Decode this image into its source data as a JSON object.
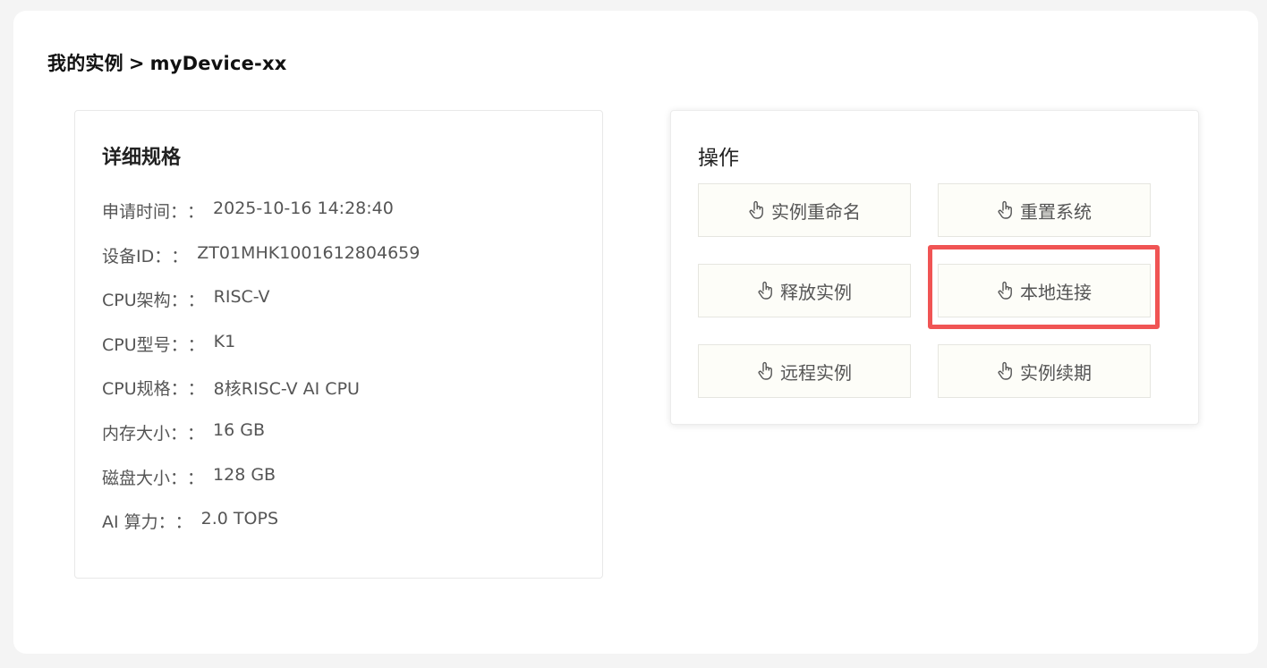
{
  "breadcrumb": {
    "parent": "我的实例",
    "separator": ">",
    "current": "myDevice-xx"
  },
  "specs": {
    "title": "详细规格",
    "colon": "：",
    "rows": [
      {
        "label": "申请时间：",
        "value": "2025-10-16 14:28:40"
      },
      {
        "label": "设备ID：",
        "value": "ZT01MHK1001612804659"
      },
      {
        "label": "CPU架构：",
        "value": "RISC-V"
      },
      {
        "label": "CPU型号：",
        "value": "K1"
      },
      {
        "label": "CPU规格：",
        "value": "8核RISC-V AI CPU"
      },
      {
        "label": "内存大小：",
        "value": "16 GB"
      },
      {
        "label": "磁盘大小：",
        "value": "128 GB"
      },
      {
        "label": "AI 算力：",
        "value": "2.0 TOPS"
      }
    ]
  },
  "operations": {
    "title": "操作",
    "icon": "pointer-hand-icon",
    "buttons": [
      {
        "label": "实例重命名"
      },
      {
        "label": "重置系统"
      },
      {
        "label": "释放实例"
      },
      {
        "label": "本地连接",
        "highlighted": true
      },
      {
        "label": "远程实例"
      },
      {
        "label": "实例续期"
      }
    ]
  },
  "colors": {
    "highlight": "#f05454",
    "button_bg": "#fdfdf8"
  }
}
